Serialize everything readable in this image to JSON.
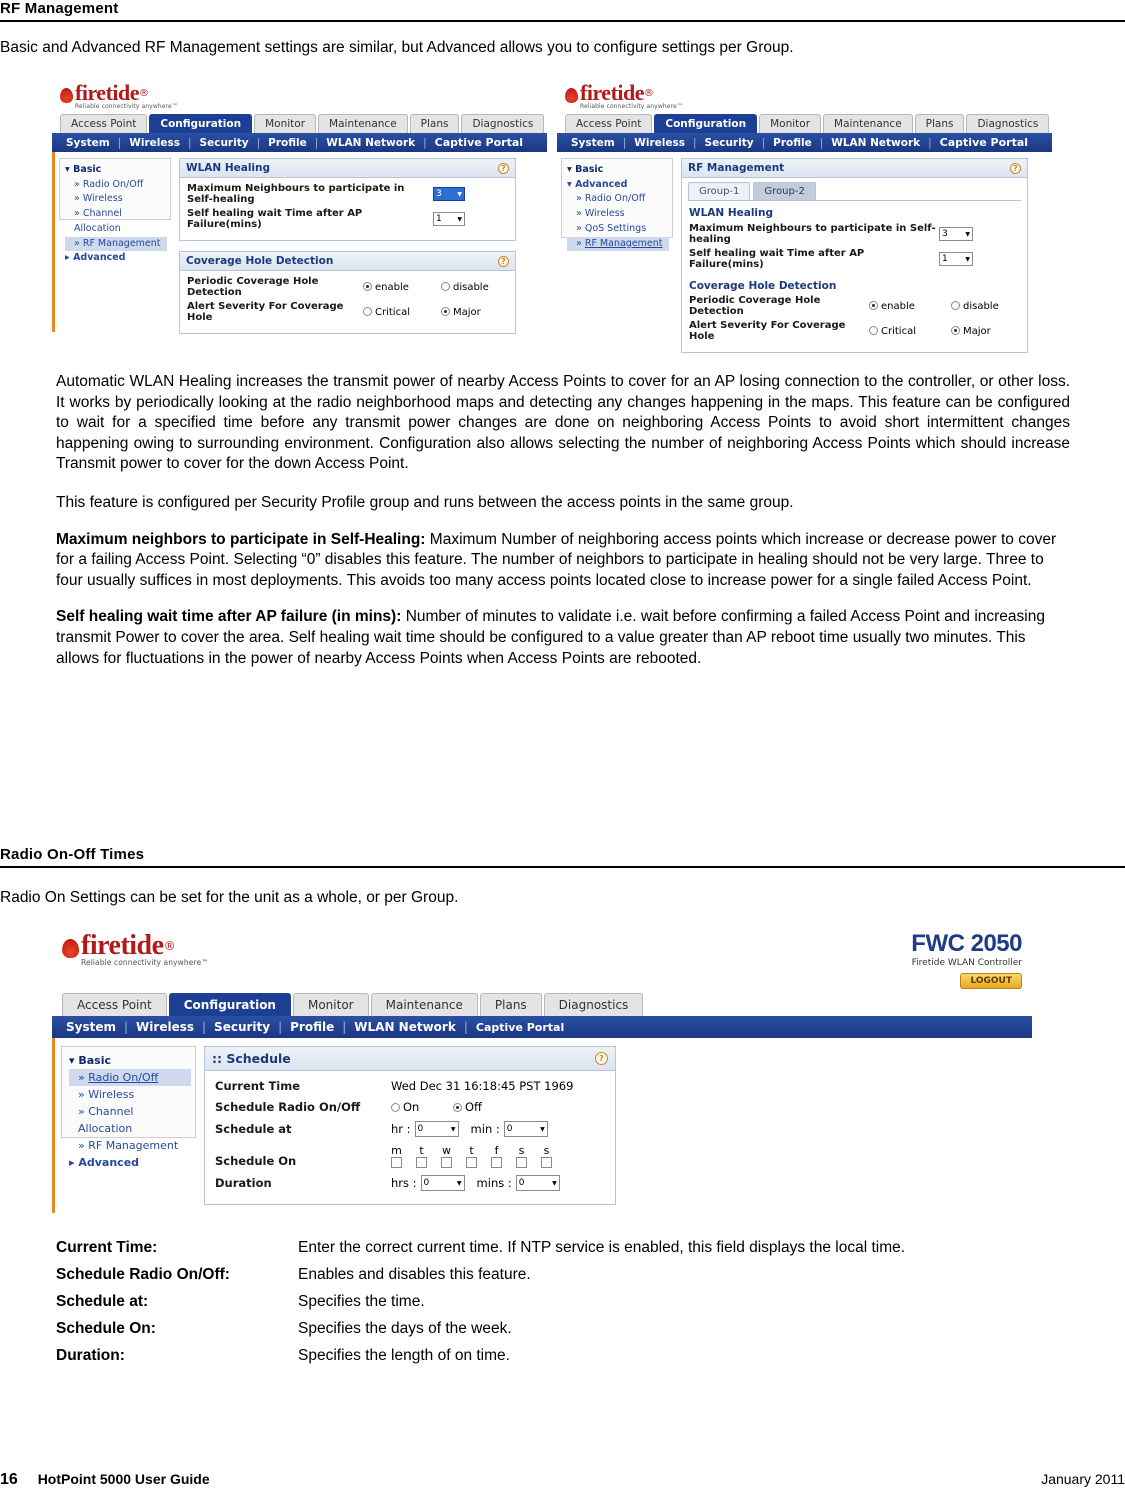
{
  "document": {
    "section1_heading": "RF Management",
    "intro1": "Basic and Advanced RF Management settings are similar, but Advanced allows you to configure settings per Group.",
    "para_auto_healing": "Automatic WLAN Healing increases the transmit power of nearby Access Points to cover for an AP losing connection to the controller, or other loss. It works by periodically looking at the radio neighborhood maps and detecting any changes happening in the maps. This feature can be configured to wait for a specified time before any transmit power changes are done on neighboring Access Points to avoid short intermittent changes happening owing to surrounding environment. Configuration also allows selecting the number of neighboring Access Points which should increase Transmit power to cover for the down Access Point.",
    "para_per_group": "This feature is configured per Security Profile group and runs between the access points in the same group.",
    "defs": [
      {
        "term": "Maximum neighbors to participate in Self-Healing:",
        "desc": "Maximum Number of neighboring access points which increase or decrease power to cover for a failing Access Point. Selecting “0” disables this feature. The number of neighbors to participate in healing should not be very large. Three to four usually suffices in most deployments. This avoids too many access points located close to increase power for a single failed Access Point."
      },
      {
        "term": "Self healing wait time after AP failure (in mins):",
        "desc": "Number of minutes to validate i.e. wait before confirming a failed Access Point and increasing transmit Power to cover the area. Self healing wait time should be configured to a value greater than AP reboot time usually two minutes. This allows for fluctuations in the power of nearby Access Points when Access Points are rebooted."
      }
    ],
    "section2_heading": "Radio On-Off Times",
    "intro2": "Radio On Settings can be set for the unit as a whole, or per Group.",
    "defs2": [
      {
        "term": "Current Time:",
        "desc": "Enter the correct current time. If NTP service is enabled, this field displays the local time."
      },
      {
        "term": "Schedule Radio On/Off:",
        "desc": "Enables and disables this feature."
      },
      {
        "term": "Schedule at:",
        "desc": "Specifies the time."
      },
      {
        "term": "Schedule On:",
        "desc": "Specifies the days of the week."
      },
      {
        "term": "Duration:",
        "desc": "Specifies the length of on time."
      }
    ],
    "footer": {
      "page_number": "16",
      "guide": "HotPoint 5000 User Guide",
      "date": "January 2011"
    }
  },
  "ui": {
    "brand": {
      "name": "firetide",
      "tagline": "Reliable connectivity anywhere™"
    },
    "tabs": [
      "Access Point",
      "Configuration",
      "Monitor",
      "Maintenance",
      "Plans",
      "Diagnostics"
    ],
    "active_tab": "Configuration",
    "navitems": [
      "System",
      "Wireless",
      "Security",
      "Profile",
      "WLAN Network",
      "Captive Portal"
    ],
    "nav_selected": "Wireless"
  },
  "shot_basic": {
    "sidebar": {
      "group1": "Basic",
      "items": [
        "Radio On/Off",
        "Wireless",
        "Channel Allocation",
        "RF Management"
      ],
      "selected": "RF Management",
      "group2": "Advanced"
    },
    "panel1": {
      "title": "WLAN Healing",
      "help": "?",
      "row1_label": "Maximum Neighbours to participate in Self-healing",
      "row1_value": "3",
      "row2_label": "Self healing wait Time after AP Failure(mins)",
      "row2_value": "1"
    },
    "panel2": {
      "title": "Coverage Hole Detection",
      "help": "?",
      "row1_label": "Periodic Coverage Hole Detection",
      "row1_opt1": "enable",
      "row1_opt2": "disable",
      "row1_selected": "enable",
      "row2_label": "Alert Severity For Coverage Hole",
      "row2_opt1": "Critical",
      "row2_opt2": "Major",
      "row2_selected": "Major"
    }
  },
  "shot_advanced": {
    "sidebar": {
      "group1": "Basic",
      "group2": "Advanced",
      "items": [
        "Radio On/Off",
        "Wireless",
        "QoS Settings",
        "RF Management"
      ],
      "selected": "RF Management"
    },
    "panel": {
      "title": "RF Management",
      "help": "?",
      "group_tabs": [
        "Group-1",
        "Group-2"
      ],
      "active_group_tab": "Group-2",
      "sub1_title": "WLAN Healing",
      "sub1_row1_label": "Maximum Neighbours to participate in Self-healing",
      "sub1_row1_value": "3",
      "sub1_row2_label": "Self healing wait Time after AP Failure(mins)",
      "sub1_row2_value": "1",
      "sub2_title": "Coverage Hole Detection",
      "sub2_row1_label": "Periodic Coverage Hole Detection",
      "sub2_row1_opt1": "enable",
      "sub2_row1_opt2": "disable",
      "sub2_row1_selected": "enable",
      "sub2_row2_label": "Alert Severity For Coverage Hole",
      "sub2_row2_opt1": "Critical",
      "sub2_row2_opt2": "Major",
      "sub2_row2_selected": "Major"
    }
  },
  "shot_schedule": {
    "product": {
      "model": "FWC 2050",
      "subtitle": "Firetide WLAN Controller",
      "logout": "LOGOUT"
    },
    "sidebar": {
      "group1": "Basic",
      "items": [
        "Radio On/Off",
        "Wireless",
        "Channel Allocation",
        "RF Management"
      ],
      "selected": "Radio On/Off",
      "group2": "Advanced"
    },
    "panel": {
      "title": "Schedule",
      "help": "?",
      "rows": {
        "current_time_label": "Current Time",
        "current_time_value": "Wed Dec 31 16:18:45 PST 1969",
        "schedule_radio_label": "Schedule Radio On/Off",
        "schedule_radio_opt1": "On",
        "schedule_radio_opt2": "Off",
        "schedule_radio_selected": "Off",
        "schedule_at_label": "Schedule at",
        "schedule_at_hr_label": "hr :",
        "schedule_at_hr_value": "0",
        "schedule_at_min_label": "min :",
        "schedule_at_min_value": "0",
        "schedule_on_label": "Schedule On",
        "days": [
          "m",
          "t",
          "w",
          "t",
          "f",
          "s",
          "s"
        ],
        "duration_label": "Duration",
        "duration_hrs_label": "hrs :",
        "duration_hrs_value": "0",
        "duration_mins_label": "mins :",
        "duration_mins_value": "0"
      }
    }
  }
}
